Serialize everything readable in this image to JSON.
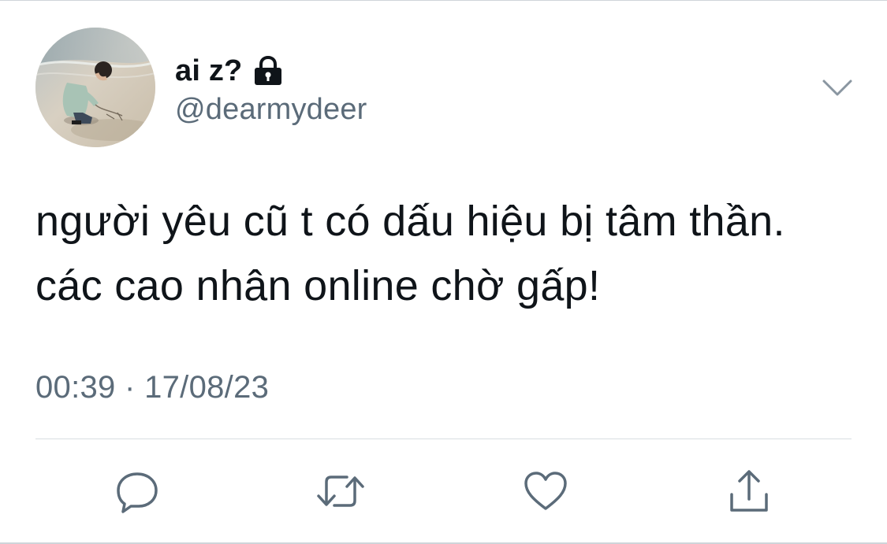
{
  "author": {
    "display_name": "ai z?",
    "handle": "@dearmydeer",
    "protected_icon": "lock-icon",
    "avatar_description_icon": "avatar"
  },
  "tweet": {
    "lines": [
      "người yêu cũ t có dấu hiệu bị tâm thần.",
      "các cao nhân online chờ gấp!"
    ],
    "time": "00:39",
    "separator": "·",
    "date": "17/08/23"
  },
  "actions": [
    {
      "name": "reply",
      "icon": "reply-icon"
    },
    {
      "name": "retweet",
      "icon": "retweet-icon"
    },
    {
      "name": "like",
      "icon": "heart-icon"
    },
    {
      "name": "share",
      "icon": "share-icon"
    }
  ],
  "menu_icon": "chevron-down-icon",
  "colors": {
    "text": "#0f1419",
    "secondary": "#5b6b79",
    "divider": "#d9dde1",
    "icon": "#5b6b79"
  }
}
